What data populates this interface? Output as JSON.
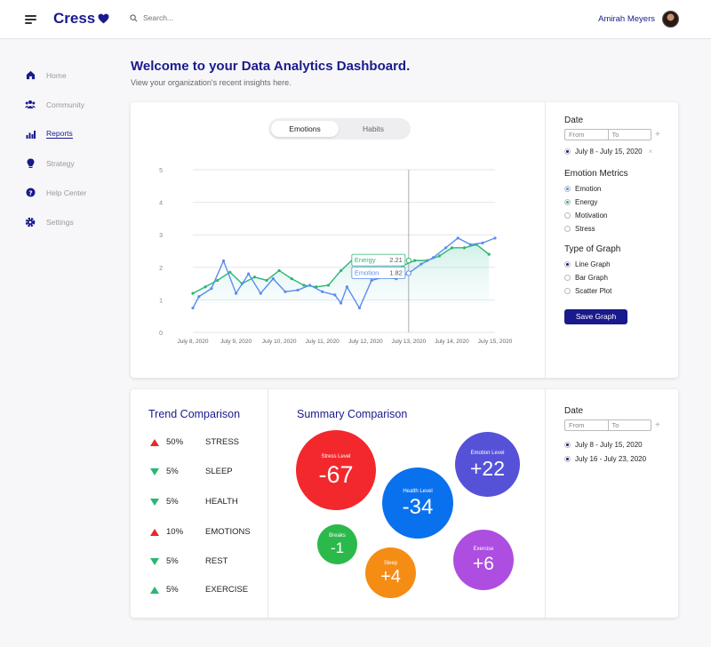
{
  "header": {
    "logo": "Cress",
    "search_placeholder": "Search...",
    "user_name": "Amirah Meyers"
  },
  "sidebar": {
    "items": [
      {
        "label": "Home",
        "icon": "home-icon"
      },
      {
        "label": "Community",
        "icon": "community-icon"
      },
      {
        "label": "Reports",
        "icon": "reports-icon",
        "active": true
      },
      {
        "label": "Strategy",
        "icon": "lightbulb-icon"
      },
      {
        "label": "Help Center",
        "icon": "help-icon"
      },
      {
        "label": "Settings",
        "icon": "gear-icon"
      }
    ]
  },
  "main": {
    "title": "Welcome to your Data Analytics Dashboard.",
    "subtitle": "View your organization's recent insights here."
  },
  "chart_card": {
    "tabs": [
      "Emotions",
      "Habits"
    ],
    "active_tab": "Emotions",
    "tooltip": {
      "energy_label": "Energy",
      "energy_value": "2.21",
      "emotion_label": "Emotion",
      "emotion_value": "1.82"
    }
  },
  "chart_data": {
    "type": "line",
    "ylim": [
      0,
      5
    ],
    "yticks": [
      "0",
      "1",
      "2",
      "3",
      "4",
      "5"
    ],
    "xticks": [
      "July 8, 2020",
      "July 9, 2020",
      "July 10, 2020",
      "July 11, 2020",
      "July 12, 2020",
      "July 13, 2020",
      "July 14, 2020",
      "July 15, 2020"
    ],
    "xlim": [
      0,
      7
    ],
    "hover_x": 5.0,
    "series": [
      {
        "name": "Energy",
        "color": "#2bb673",
        "x": [
          0,
          0.29,
          0.57,
          0.86,
          1.14,
          1.43,
          1.71,
          2.0,
          2.29,
          2.57,
          2.86,
          3.14,
          3.43,
          3.71,
          4.0,
          4.29,
          4.57,
          4.86,
          5.14,
          5.43,
          5.71,
          6.0,
          6.29,
          6.57,
          6.86
        ],
        "values": [
          1.2,
          1.4,
          1.6,
          1.85,
          1.5,
          1.7,
          1.6,
          1.9,
          1.65,
          1.45,
          1.4,
          1.45,
          1.9,
          2.25,
          2.35,
          2.35,
          2.35,
          2.05,
          2.21,
          2.21,
          2.35,
          2.6,
          2.6,
          2.7,
          2.4
        ]
      },
      {
        "name": "Emotion",
        "color": "#5b8def",
        "x": [
          0,
          0.14,
          0.43,
          0.71,
          1.0,
          1.29,
          1.57,
          1.86,
          2.14,
          2.43,
          2.71,
          3.0,
          3.29,
          3.43,
          3.57,
          3.86,
          4.14,
          4.43,
          4.71,
          5.0,
          5.29,
          5.57,
          5.86,
          6.14,
          6.43,
          6.71,
          7.0
        ],
        "values": [
          0.75,
          1.1,
          1.35,
          2.2,
          1.2,
          1.8,
          1.2,
          1.65,
          1.25,
          1.3,
          1.45,
          1.25,
          1.15,
          0.9,
          1.4,
          0.75,
          1.6,
          1.7,
          1.65,
          1.82,
          2.1,
          2.3,
          2.6,
          2.9,
          2.7,
          2.75,
          2.9
        ]
      }
    ]
  },
  "filters": {
    "date_heading": "Date",
    "from_placeholder": "From",
    "to_placeholder": "To",
    "plus": "+",
    "date_ranges": [
      "July 8 - July 15, 2020"
    ],
    "remove": "×",
    "metrics_heading": "Emotion Metrics",
    "metrics": [
      {
        "label": "Emotion",
        "color": "#5b8def",
        "selected": true
      },
      {
        "label": "Energy",
        "color": "#2bb673",
        "selected": true
      },
      {
        "label": "Motivation",
        "color": "#1a1a8c",
        "selected": false
      },
      {
        "label": "Stress",
        "color": "#1a1a8c",
        "selected": false
      }
    ],
    "graph_heading": "Type of Graph",
    "graph_types": [
      {
        "label": "Line Graph",
        "selected": true
      },
      {
        "label": "Bar Graph",
        "selected": false
      },
      {
        "label": "Scatter Plot",
        "selected": false
      }
    ],
    "save_label": "Save Graph"
  },
  "trend": {
    "title": "Trend Comparison",
    "rows": [
      {
        "pct": "50%",
        "label": "STRESS",
        "direction": "up",
        "color": "#e8282b"
      },
      {
        "pct": "5%",
        "label": "SLEEP",
        "direction": "down",
        "color": "#2bb673"
      },
      {
        "pct": "5%",
        "label": "HEALTH",
        "direction": "down",
        "color": "#2bb673"
      },
      {
        "pct": "10%",
        "label": "EMOTIONS",
        "direction": "up",
        "color": "#e8282b"
      },
      {
        "pct": "5%",
        "label": "REST",
        "direction": "down",
        "color": "#2bb673"
      },
      {
        "pct": "5%",
        "label": "EXERCISE",
        "direction": "up",
        "color": "#2bb673"
      }
    ]
  },
  "summary": {
    "title": "Summary Comparison",
    "bubbles": [
      {
        "label": "Stress Level",
        "value": "-67",
        "color": "#f2282d"
      },
      {
        "label": "Emotion Level",
        "value": "+22",
        "color": "#5652d8"
      },
      {
        "label": "Health Level",
        "value": "-34",
        "color": "#0a71ee"
      },
      {
        "label": "Breaks",
        "value": "-1",
        "color": "#2cb94c"
      },
      {
        "label": "Sleep",
        "value": "+4",
        "color": "#f58c14"
      },
      {
        "label": "Exercise",
        "value": "+6",
        "color": "#ad4ee0"
      }
    ]
  },
  "summary_filters": {
    "date_heading": "Date",
    "from_placeholder": "From",
    "to_placeholder": "To",
    "plus": "+",
    "date_ranges": [
      "July 8 - July 15, 2020",
      "July 16 - July 23, 2020"
    ]
  }
}
